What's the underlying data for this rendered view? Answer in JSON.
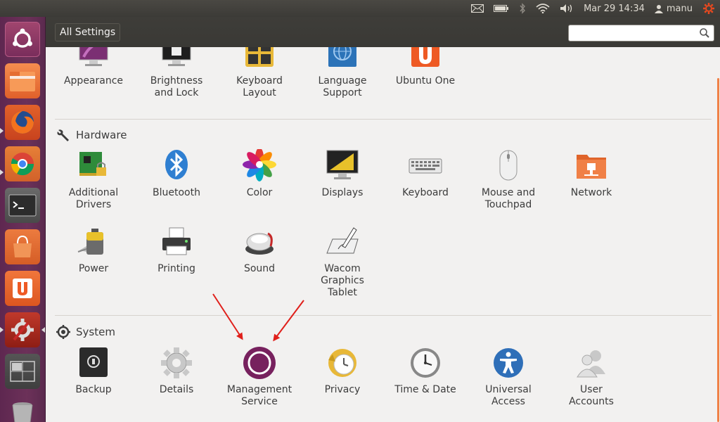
{
  "top_panel": {
    "datetime": "Mar 29 14:34",
    "user": "manu",
    "icons": [
      "mail-icon",
      "battery-icon",
      "bluetooth-icon",
      "wifi-icon",
      "volume-icon",
      "user-icon",
      "power-gear-icon"
    ]
  },
  "header": {
    "all_settings_label": "All Settings",
    "search_value": "",
    "search_placeholder": ""
  },
  "launcher": {
    "items": [
      "ubuntu-dash-icon",
      "files-icon",
      "firefox-icon",
      "chrome-icon",
      "terminal-icon",
      "software-center-icon",
      "ubuntu-one-icon",
      "system-settings-icon",
      "workspace-switcher-icon",
      "trash-icon"
    ]
  },
  "personal": {
    "items": [
      {
        "label": "Appearance",
        "icon": "appearance-icon"
      },
      {
        "label": "Brightness\nand Lock",
        "icon": "brightness-lock-icon"
      },
      {
        "label": "Keyboard\nLayout",
        "icon": "keyboard-layout-icon"
      },
      {
        "label": "Language\nSupport",
        "icon": "language-support-icon"
      },
      {
        "label": "Ubuntu One",
        "icon": "ubuntu-one-icon"
      }
    ]
  },
  "hardware": {
    "title": "Hardware",
    "items": [
      {
        "label": "Additional\nDrivers",
        "icon": "drivers-icon"
      },
      {
        "label": "Bluetooth",
        "icon": "bluetooth-icon"
      },
      {
        "label": "Color",
        "icon": "color-icon"
      },
      {
        "label": "Displays",
        "icon": "displays-icon"
      },
      {
        "label": "Keyboard",
        "icon": "keyboard-icon"
      },
      {
        "label": "Mouse and\nTouchpad",
        "icon": "mouse-icon"
      },
      {
        "label": "Network",
        "icon": "network-icon"
      },
      {
        "label": "Power",
        "icon": "power-icon"
      },
      {
        "label": "Printing",
        "icon": "printer-icon"
      },
      {
        "label": "Sound",
        "icon": "sound-icon"
      },
      {
        "label": "Wacom\nGraphics\nTablet",
        "icon": "wacom-tablet-icon"
      }
    ]
  },
  "system": {
    "title": "System",
    "items": [
      {
        "label": "Backup",
        "icon": "backup-icon"
      },
      {
        "label": "Details",
        "icon": "details-gear-icon"
      },
      {
        "label": "Management\nService",
        "icon": "management-service-icon"
      },
      {
        "label": "Privacy",
        "icon": "privacy-icon"
      },
      {
        "label": "Time & Date",
        "icon": "clock-icon"
      },
      {
        "label": "Universal\nAccess",
        "icon": "universal-access-icon"
      },
      {
        "label": "User\nAccounts",
        "icon": "user-accounts-icon"
      }
    ]
  },
  "colors": {
    "launcher": "#6c3159",
    "panel": "#3c3b37",
    "background": "#f2f1f0",
    "accent": "#f08046",
    "annotation_arrow": "#e0201b",
    "management_ring": "#77215e"
  }
}
